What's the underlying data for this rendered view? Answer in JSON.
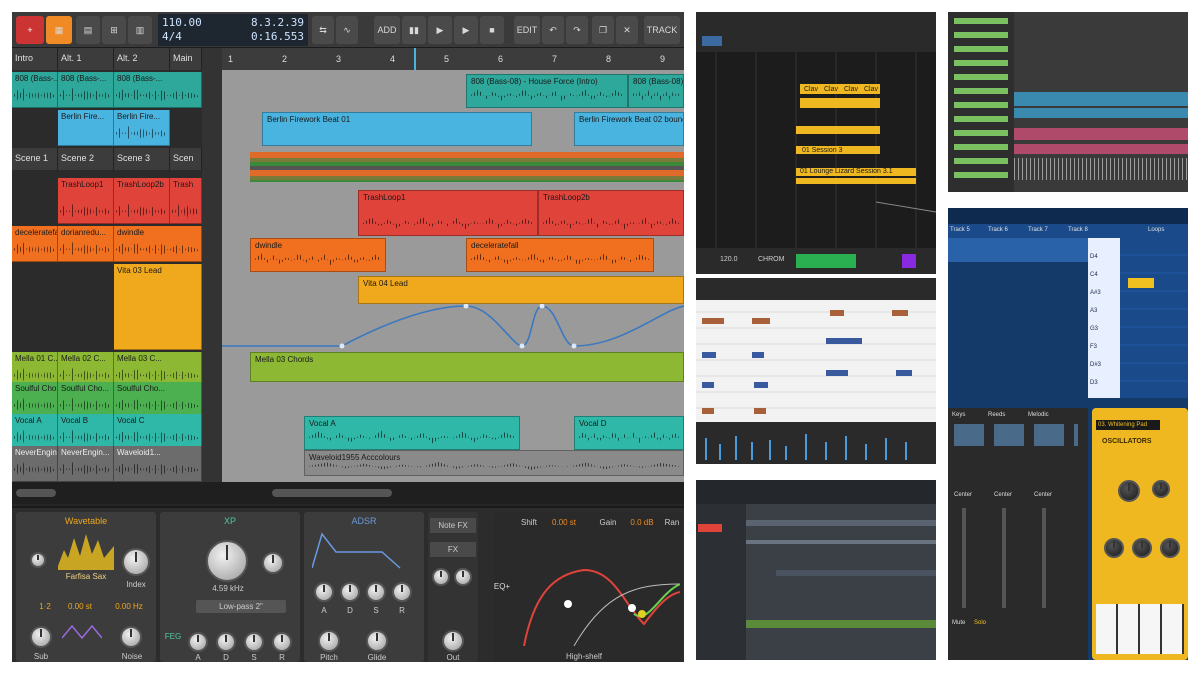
{
  "transport": {
    "tempo": "110.00",
    "time_signature": "4/4",
    "position": "8.3.2.39",
    "time": "0:16.553",
    "add_label": "ADD",
    "edit_label": "EDIT",
    "track_label": "TRACK"
  },
  "scenes": [
    "Intro",
    "Alt. 1",
    "Alt. 2",
    "Main"
  ],
  "scene_row": [
    "Scene 1",
    "Scene 2",
    "Scene 3",
    "Scen"
  ],
  "launcher_clips": [
    [
      "808 (Bass-...",
      "808 (Bass-...",
      "808 (Bass-..."
    ],
    [
      "",
      "Berlin Fire...",
      "Berlin Fire..."
    ],
    [
      "TrashLoop1",
      "TrashLoop2b",
      "Trash"
    ],
    [
      "deceleratefall",
      "dorianredu...",
      "dwindle"
    ],
    [
      "",
      "Vita 03 Lead",
      ""
    ],
    [
      "Mella 01 C...",
      "Mella 02 C...",
      "Mella 03 C..."
    ],
    [
      "Soulful Cho...",
      "Soulful Cho...",
      "Soulful Cho..."
    ],
    [
      "Vocal A",
      "Vocal B",
      "Vocal C"
    ],
    [
      "NeverEngin...",
      "NeverEngin...",
      "Waveloid1..."
    ]
  ],
  "ruler_numbers": [
    "1",
    "2",
    "3",
    "4",
    "5",
    "6",
    "7",
    "8",
    "9"
  ],
  "arranger_clips": {
    "c808": "808 (Bass-08) - House Force (Intro)",
    "c808b": "808 (Bass-08)",
    "berlin1": "Berlin Firework Beat 01",
    "berlin2": "Berlin Firework Beat 02 bounce-1",
    "trash1": "TrashLoop1",
    "trash2": "TrashLoop2b",
    "dwindle": "dwindle",
    "decel": "deceleratefall",
    "vita": "Vita 04 Lead",
    "mella": "Mella 03 Chords",
    "vocalA": "Vocal A",
    "vocalD": "Vocal D",
    "waveloid": "Waveloid1955 Acccolours"
  },
  "devices": {
    "wavetable_title": "Wavetable",
    "wavetable_patch": "Farfisa Sax",
    "index_label": "Index",
    "wt_values": [
      "1·2",
      "0.00 st",
      "0.00 Hz"
    ],
    "xp_title": "XP",
    "xp_freq": "4.59 kHz",
    "xp_filter": "Low-pass 2\"",
    "adsr_title": "ADSR",
    "adsr_labels": [
      "A",
      "D",
      "S",
      "R"
    ],
    "notefx_label": "Note FX",
    "fx_label": "FX",
    "shift_label": "Shift",
    "shift_value": "0.00 st",
    "gain_label": "Gain",
    "gain_value": "0.0 dB",
    "range_label": "Ran",
    "bottom_labels": [
      "Sub",
      "Noise",
      "A",
      "D",
      "S",
      "R",
      "Pitch",
      "Glide",
      "Out"
    ],
    "feg_label": "FEG",
    "high_shelf": "High-shelf",
    "eq_label": "EQ+"
  },
  "overlay": {
    "tempo": "120.0",
    "chrom": "CHROM",
    "notes": [
      "D4",
      "C4",
      "A#3",
      "A3",
      "G3",
      "F3",
      "D#3",
      "D3"
    ],
    "track_headers": [
      "Track 5",
      "Track 6",
      "Track 7",
      "Track 8"
    ],
    "loops_label": "Loops",
    "oscillators": "OSCILLATORS",
    "patch": "03. Whitening Pad",
    "channels": [
      "Keys",
      "Reeds",
      "Melodic"
    ],
    "mixer_labels": [
      "Center",
      "Center",
      "Center"
    ],
    "solo": "Solo",
    "mute": "Mute",
    "clip_labels": [
      "Clav",
      "Clav",
      "Clav",
      "Clav"
    ],
    "session": "01 Session 3",
    "lounge": "01 Lounge Lizard Session 3.1"
  }
}
